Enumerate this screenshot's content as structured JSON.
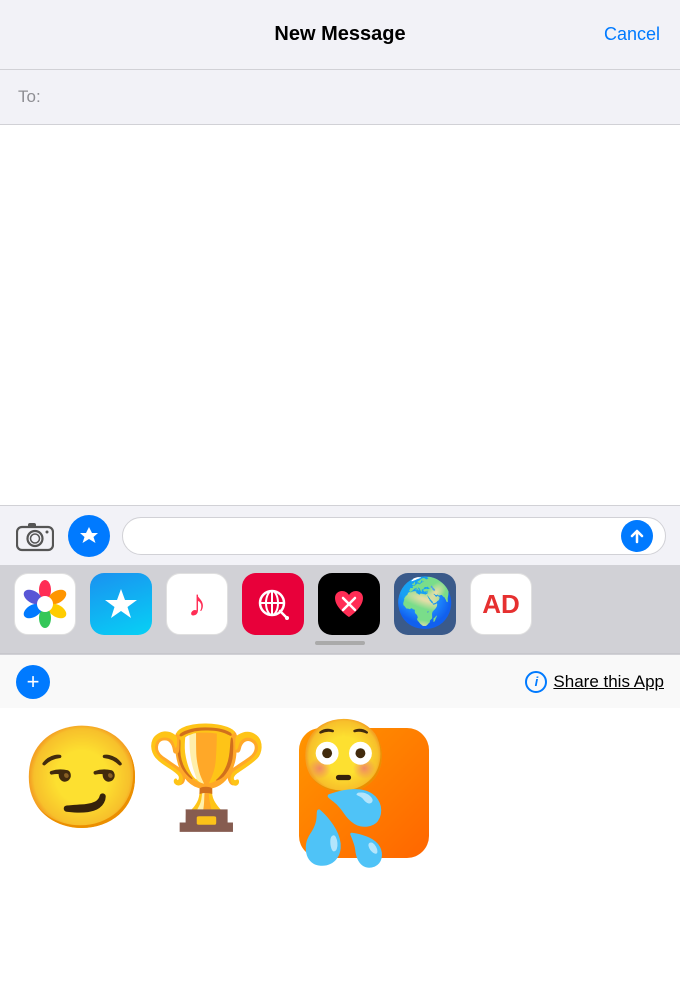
{
  "header": {
    "title": "New Message",
    "cancel_label": "Cancel"
  },
  "to_field": {
    "label": "To:"
  },
  "message_input": {
    "placeholder": ""
  },
  "app_strip": {
    "apps": [
      {
        "name": "Photos",
        "type": "photos"
      },
      {
        "name": "App Store",
        "type": "appstore"
      },
      {
        "name": "Music",
        "type": "music"
      },
      {
        "name": "Search",
        "type": "search"
      },
      {
        "name": "Heart Delete",
        "type": "heart"
      },
      {
        "name": "Globe",
        "type": "globe"
      },
      {
        "name": "Ad",
        "type": "ad"
      }
    ]
  },
  "bottom_bar": {
    "plus_label": "+",
    "info_label": "i",
    "share_text": "Share this App"
  },
  "emojis": [
    {
      "type": "trophy-wink",
      "label": "Winking face with trophy"
    },
    {
      "type": "embarrassed-sweat",
      "label": "Embarrassed face with sweat"
    }
  ]
}
